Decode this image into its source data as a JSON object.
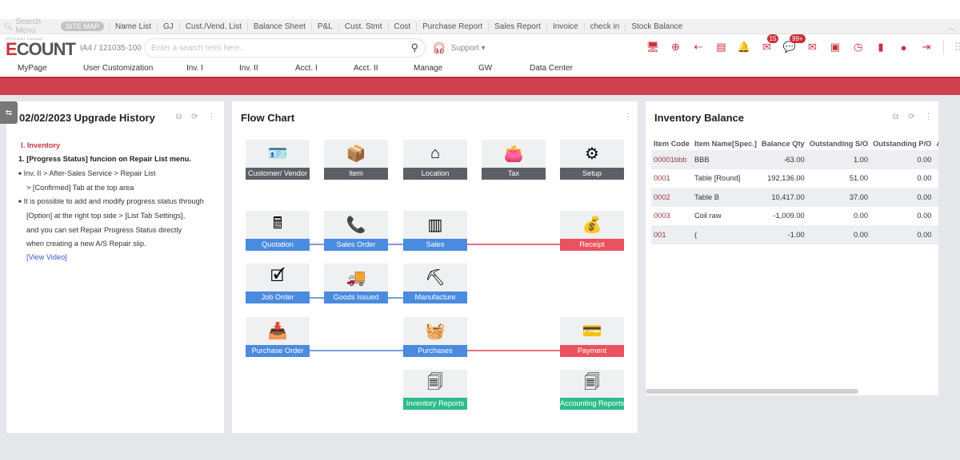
{
  "menubar": {
    "search_placeholder": "Search Menu",
    "sitemap_label": "SITE MAP",
    "quick_links": [
      "Name List",
      "GJ",
      "Cust./Vend. List",
      "Balance Sheet",
      "P&L",
      "Cust. Stmt",
      "Cost",
      "Purchase Report",
      "Sales Report",
      "Invoice",
      "check in",
      "Stock Balance"
    ],
    "collapse_icon": "chevron-up-icon"
  },
  "header": {
    "logo_tag": "EFFICIENT CHANGE",
    "logo_e": "E",
    "logo_rest": "COUNT",
    "account": "IA4 / 121035-100",
    "search_placeholder": "Enter a search term here..",
    "support_label": "Support ▾",
    "toolbar_icons": [
      {
        "name": "monitor-icon",
        "glyph": "🖥",
        "badge": null
      },
      {
        "name": "new-window-icon",
        "glyph": "⊕",
        "badge": null
      },
      {
        "name": "back-arrow-icon",
        "glyph": "⇠",
        "badge": null
      },
      {
        "name": "document-list-icon",
        "glyph": "▤",
        "badge": null
      },
      {
        "name": "bell-icon",
        "glyph": "🔔",
        "badge": null
      },
      {
        "name": "approval-mail-icon",
        "glyph": "✉",
        "badge": "15"
      },
      {
        "name": "chat-icon",
        "glyph": "💬",
        "badge": "99+"
      },
      {
        "name": "mail-icon",
        "glyph": "✉",
        "badge": null
      },
      {
        "name": "card-hand-icon",
        "glyph": "▣",
        "badge": null
      },
      {
        "name": "clock-icon",
        "glyph": "◷",
        "badge": null
      },
      {
        "name": "bookmark-book-icon",
        "glyph": "▮",
        "badge": null
      },
      {
        "name": "user-icon",
        "glyph": "●",
        "badge": null
      },
      {
        "name": "logout-icon",
        "glyph": "⇥",
        "badge": null
      }
    ],
    "apps_icon": "grid-icon"
  },
  "nav": [
    "MyPage",
    "User Customization",
    "Inv. I",
    "Inv. II",
    "Acct. I",
    "Acct. II",
    "Manage",
    "GW",
    "Data Center"
  ],
  "upgrade_panel": {
    "title": "02/02/2023 Upgrade History",
    "section": "Ⅰ. Inventory",
    "heading": "1. [Progress Status] funcion on Repair List menu.",
    "lines": [
      {
        "text": "Inv. II  > After-Sales Service > Repair List",
        "type": "bullet"
      },
      {
        "text": "> [Confirmed] Tab at the top area",
        "type": "indent"
      },
      {
        "text": "It is possible to add and modify progress status through",
        "type": "bullet"
      },
      {
        "text": "[Option] at the right top side > [List Tab Settings],",
        "type": "indent"
      },
      {
        "text": "and you can set Repair Progress Status directly",
        "type": "indent"
      },
      {
        "text": "when creating a new A/S Repair slip.",
        "type": "indent"
      }
    ],
    "link": "[View Video]"
  },
  "flow_chart": {
    "title": "Flow Chart",
    "tiles": [
      {
        "id": "customer-vendor",
        "label": "Customer/ Vendor",
        "color": "gray",
        "icon": "contact-card-icon",
        "glyph": "🪪"
      },
      {
        "id": "item",
        "label": "Item",
        "color": "gray",
        "icon": "box-icon",
        "glyph": "📦"
      },
      {
        "id": "location",
        "label": "Location",
        "color": "gray",
        "icon": "house-icon",
        "glyph": "⌂"
      },
      {
        "id": "tax",
        "label": "Tax",
        "color": "gray",
        "icon": "wallet-icon",
        "glyph": "👛"
      },
      {
        "id": "setup",
        "label": "Setup",
        "color": "gray",
        "icon": "document-gear-icon",
        "glyph": "⚙"
      },
      {
        "id": "quotation",
        "label": "Quotation",
        "color": "blue",
        "icon": "calculator-icon",
        "glyph": "🖩"
      },
      {
        "id": "sales-order",
        "label": "Sales Order",
        "color": "blue",
        "icon": "phone-icon",
        "glyph": "📞"
      },
      {
        "id": "sales",
        "label": "Sales",
        "color": "blue",
        "icon": "barcode-icon",
        "glyph": "▥"
      },
      {
        "id": "receipt",
        "label": "Receipt",
        "color": "red",
        "icon": "cash-coins-icon",
        "glyph": "💰"
      },
      {
        "id": "job-order",
        "label": "Job Order",
        "color": "blue",
        "icon": "checked-document-icon",
        "glyph": "🗹"
      },
      {
        "id": "goods-issued",
        "label": "Goods Issued",
        "color": "blue",
        "icon": "truck-icon",
        "glyph": "🚚"
      },
      {
        "id": "manufacture",
        "label": "Manufacture",
        "color": "blue",
        "icon": "oil-pump-icon",
        "glyph": "⛏"
      },
      {
        "id": "purchase-order",
        "label": "Purchase Order",
        "color": "blue",
        "icon": "inbox-document-icon",
        "glyph": "📥"
      },
      {
        "id": "purchases",
        "label": "Purchases",
        "color": "blue",
        "icon": "basket-icon",
        "glyph": "🧺"
      },
      {
        "id": "payment",
        "label": "Payment",
        "color": "red",
        "icon": "credit-card-icon",
        "glyph": "💳"
      },
      {
        "id": "inventory-reports",
        "label": "Inventory Reports",
        "color": "green",
        "icon": "documents-icon",
        "glyph": "🗐"
      },
      {
        "id": "accounting-reports",
        "label": "Accounting Reports",
        "color": "green",
        "icon": "documents-icon",
        "glyph": "🗐"
      }
    ]
  },
  "inventory_balance": {
    "title": "Inventory Balance",
    "columns": [
      "Item Code",
      "Item Name[Spec.]",
      "Balance Qty",
      "Outstanding S/O",
      "Outstanding P/O",
      "A"
    ],
    "rows": [
      [
        "00001bbb",
        "BBB",
        "-63.00",
        "1.00",
        "0.00"
      ],
      [
        "0001",
        "Table [Round]",
        "192,136.00",
        "51.00",
        "0.00"
      ],
      [
        "0002",
        "Table B",
        "10,417.00",
        "37.00",
        "0.00"
      ],
      [
        "0003",
        "Coil raw",
        "-1,009.00",
        "0.00",
        "0.00"
      ],
      [
        "001",
        "(",
        "-1.00",
        "0.00",
        "0.00"
      ]
    ]
  },
  "colors": {
    "brand_red": "#c8323d",
    "flow_blue": "#4a8be0",
    "flow_red": "#e9525e",
    "flow_green": "#2dbd8a",
    "flow_gray": "#5c6066"
  }
}
